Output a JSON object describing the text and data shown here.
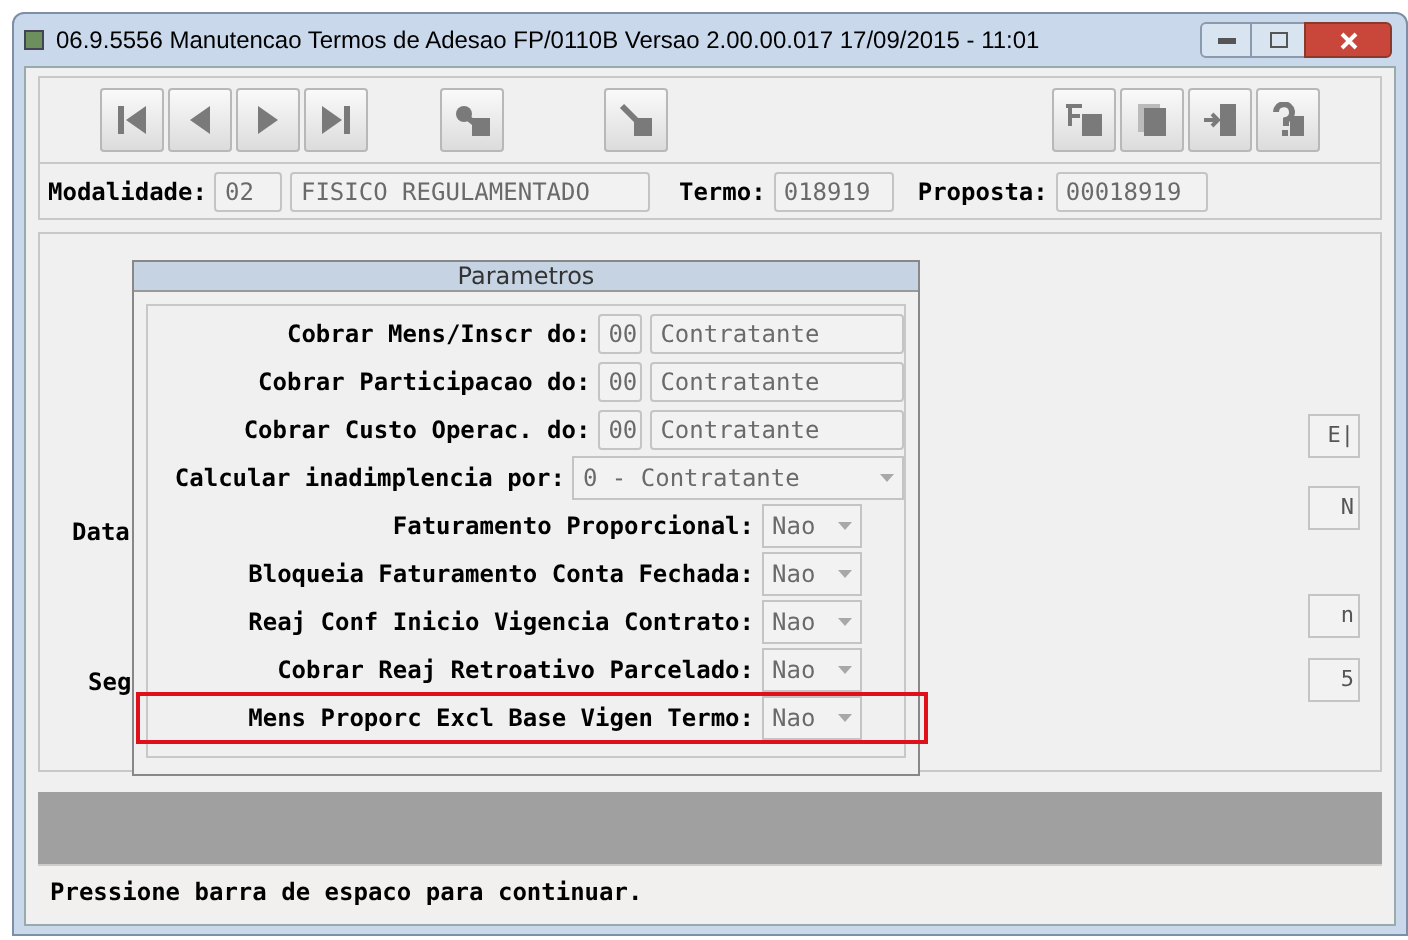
{
  "window": {
    "title": "06.9.5556 Manutencao  Termos de Adesao FP/0110B Versao 2.00.00.017 17/09/2015 - 11:01"
  },
  "header": {
    "modalidade_label": "Modalidade:",
    "modalidade_code": "02",
    "modalidade_name": "FISICO REGULAMENTADO",
    "termo_label": "Termo:",
    "termo": "018919",
    "proposta_label": "Proposta:",
    "proposta": "00018919"
  },
  "background_labels": [
    "Data",
    "Seg"
  ],
  "background_fields": [
    "E|",
    "N",
    "n",
    "5"
  ],
  "dialog": {
    "title": "Parametros",
    "params": [
      {
        "kind": "code",
        "label": "Cobrar Mens/Inscr do:",
        "code": "00",
        "value": "Contratante",
        "highlighted": false
      },
      {
        "kind": "code",
        "label": "Cobrar Participacao do:",
        "code": "00",
        "value": "Contratante",
        "highlighted": false
      },
      {
        "kind": "code",
        "label": "Cobrar Custo Operac. do:",
        "code": "00",
        "value": "Contratante",
        "highlighted": false
      },
      {
        "kind": "wide",
        "label": "Calcular inadimplencia por:",
        "value": "0 - Contratante",
        "highlighted": false
      },
      {
        "kind": "select",
        "label": "Faturamento Proporcional:",
        "value": "Nao",
        "highlighted": false
      },
      {
        "kind": "select",
        "label": "Bloqueia Faturamento Conta Fechada:",
        "value": "Nao",
        "highlighted": false
      },
      {
        "kind": "select",
        "label": "Reaj Conf Inicio Vigencia Contrato:",
        "value": "Nao",
        "highlighted": false
      },
      {
        "kind": "select",
        "label": "Cobrar Reaj Retroativo Parcelado:",
        "value": "Nao",
        "highlighted": false
      },
      {
        "kind": "select",
        "label": "Mens Proporc Excl Base Vigen Termo:",
        "value": "Nao",
        "highlighted": true
      }
    ]
  },
  "status_bar": "Pressione barra de espaco para continuar."
}
